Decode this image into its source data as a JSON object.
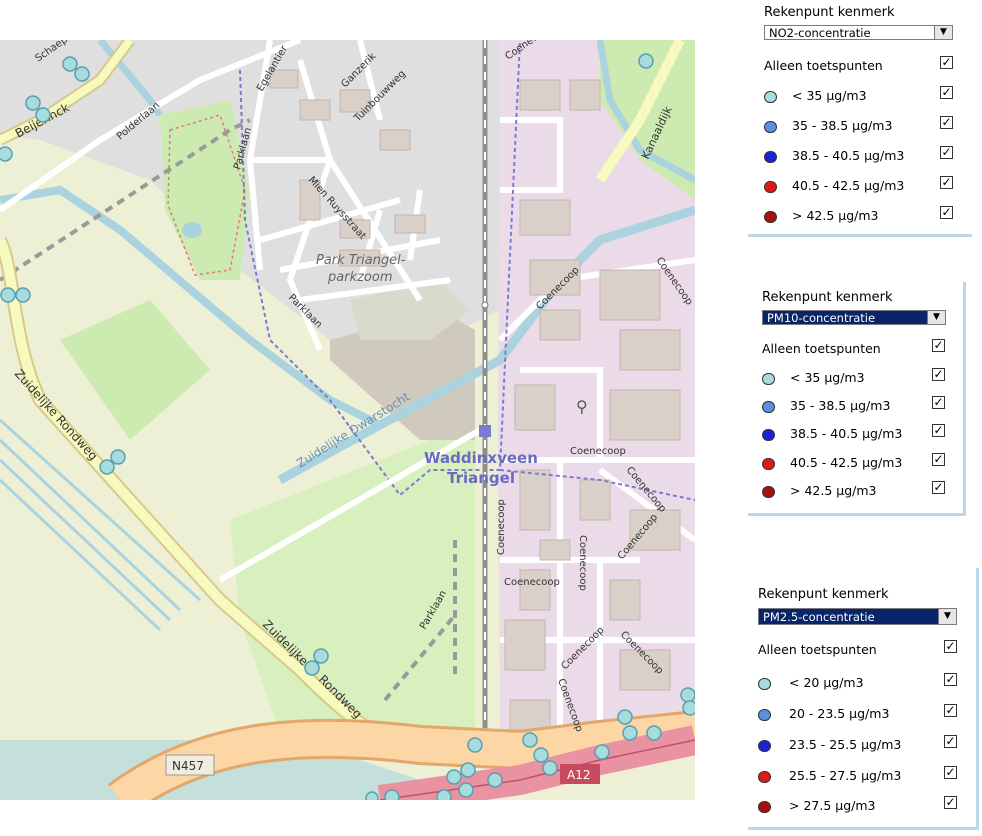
{
  "map": {
    "labels": {
      "schaepman": "Schaepm",
      "beijerinck": "Beijerinck",
      "polderlaan": "Polderlaan",
      "egelantier": "Egelantier",
      "ganzerik": "Ganzerik",
      "tuinbouwweg": "Tuinbouwweg",
      "parklaan_1": "Parklaan",
      "parklaan_2": "Parklaan",
      "parklaan_3": "Parklaan",
      "mien": "Mien Ruysstraat",
      "park_triangel_1": "Park Triangel-",
      "park_triangel_2": "parkzoom",
      "dwarstocht": "Zuidelijke Dwarstocht",
      "zuidelijke_rondweg_1": "Zuidelijke Rondweg",
      "zuidelijke_rondweg_2a": "Zuidelijke",
      "zuidelijke_rondweg_2b": "Rondweg",
      "kanaaldijk": "Kanaaldijk",
      "coenecoop": "Coenecoop",
      "station_1": "Waddinxveen",
      "station_2": "Triangel",
      "n457": "N457",
      "a12": "A12"
    },
    "colors": {
      "land": "#f2efe9",
      "farmland": "#eef0d5",
      "grass": "#cdebb0",
      "industrial": "#ebdbe8",
      "residential": "#e0dfdf",
      "water": "#aad3df",
      "motorway": "#e892a2",
      "trunk": "#fcd6a4",
      "secondary": "#f7fabf",
      "boundary": "#7a7ad0",
      "marker": "#a8dcdc"
    }
  },
  "panels": [
    {
      "title": "Rekenpunt kenmerk",
      "selected": "NO2-concentratie",
      "filter_label": "Alleen toetspunten",
      "legend": [
        {
          "label": "< 35 µg/m3",
          "color": "#a8dcdc"
        },
        {
          "label": "35 - 38.5 µg/m3",
          "color": "#5b8fe0"
        },
        {
          "label": "38.5 - 40.5 µg/m3",
          "color": "#1a22d8"
        },
        {
          "label": "40.5 - 42.5 µg/m3",
          "color": "#e01818"
        },
        {
          "label": "> 42.5 µg/m3",
          "color": "#a81010"
        }
      ]
    },
    {
      "title": "Rekenpunt kenmerk",
      "selected": "PM10-concentratie",
      "filter_label": "Alleen toetspunten",
      "legend": [
        {
          "label": "< 35 µg/m3",
          "color": "#a8dcdc"
        },
        {
          "label": "35 - 38.5 µg/m3",
          "color": "#5b8fe0"
        },
        {
          "label": "38.5 - 40.5 µg/m3",
          "color": "#1a22d8"
        },
        {
          "label": "40.5 - 42.5 µg/m3",
          "color": "#e01818"
        },
        {
          "label": "> 42.5 µg/m3",
          "color": "#a81010"
        }
      ]
    },
    {
      "title": "Rekenpunt kenmerk",
      "selected": "PM2.5-concentratie",
      "filter_label": "Alleen toetspunten",
      "legend": [
        {
          "label": "< 20 µg/m3",
          "color": "#a8dcdc"
        },
        {
          "label": "20 - 23.5 µg/m3",
          "color": "#5b8fe0"
        },
        {
          "label": "23.5 - 25.5 µg/m3",
          "color": "#1a22d8"
        },
        {
          "label": "25.5 - 27.5 µg/m3",
          "color": "#e01818"
        },
        {
          "label": "> 27.5 µg/m3",
          "color": "#a81010"
        }
      ]
    }
  ]
}
